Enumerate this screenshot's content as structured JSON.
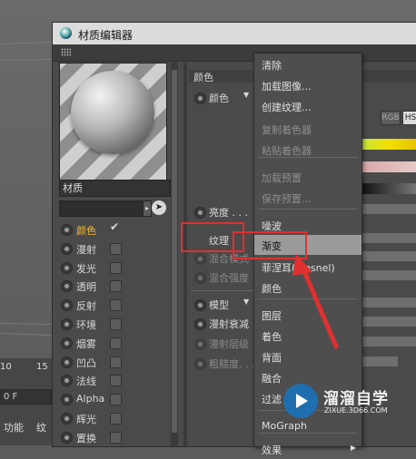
{
  "window": {
    "title": "材质编辑器"
  },
  "left_strip": {
    "frame_a": "10",
    "frame_b": "15",
    "field": "0 F",
    "tab_a": "功能",
    "tab_b": "纹"
  },
  "material": {
    "name": "材质"
  },
  "channels": [
    {
      "label": "颜色",
      "active": true,
      "checked": true
    },
    {
      "label": "漫射",
      "active": false,
      "checked": false
    },
    {
      "label": "发光",
      "active": false,
      "checked": false
    },
    {
      "label": "透明",
      "active": false,
      "checked": false
    },
    {
      "label": "反射",
      "active": false,
      "checked": false
    },
    {
      "label": "环境",
      "active": false,
      "checked": false
    },
    {
      "label": "烟雾",
      "active": false,
      "checked": false
    },
    {
      "label": "凹凸",
      "active": false,
      "checked": false
    },
    {
      "label": "法线",
      "active": false,
      "checked": false
    },
    {
      "label": "Alpha",
      "active": false,
      "checked": false
    },
    {
      "label": "辉光",
      "active": false,
      "checked": false
    },
    {
      "label": "置换",
      "active": false,
      "checked": false
    }
  ],
  "panel": {
    "section_title": "颜色",
    "color_label": "颜色",
    "brightness_label": "亮度 . . .",
    "texture_label": "纹理",
    "mix_mode_label": "混合模式",
    "mix_strength_label": "混合强度",
    "model_label": "模型",
    "diffuse_falloff_label": "漫射衰减",
    "diffuse_level_label": "漫射层级",
    "roughness_label": "粗糙度. . .",
    "rgb_label": "RGB",
    "hs_label": "HS"
  },
  "context_menu": {
    "items": [
      {
        "label": "清除",
        "enabled": true
      },
      {
        "label": "加载图像...",
        "enabled": true
      },
      {
        "label": "创建纹理...",
        "enabled": true
      },
      {
        "label": "复制着色器",
        "enabled": false
      },
      {
        "label": "粘贴着色器",
        "enabled": false
      },
      {
        "label": "加载预置",
        "enabled": false
      },
      {
        "label": "保存预置...",
        "enabled": false
      },
      {
        "label": "噪波",
        "enabled": true
      },
      {
        "label": "渐变",
        "enabled": true,
        "highlighted": true
      },
      {
        "label": "菲涅耳(Fresnel)",
        "enabled": true
      },
      {
        "label": "颜色",
        "enabled": true
      },
      {
        "label": "图层",
        "enabled": true
      },
      {
        "label": "着色",
        "enabled": true
      },
      {
        "label": "背面",
        "enabled": true
      },
      {
        "label": "融合",
        "enabled": true
      },
      {
        "label": "过滤",
        "enabled": true
      },
      {
        "label": "MoGraph",
        "enabled": true
      },
      {
        "label": "效果",
        "enabled": true
      }
    ]
  },
  "watermark": {
    "title": "溜溜自学",
    "url": "ZIXUE.3D66.COM"
  },
  "colors": {
    "accent": "#f2b83a",
    "annotation": "#e03030",
    "menu_highlight": "#9a9a9a"
  }
}
